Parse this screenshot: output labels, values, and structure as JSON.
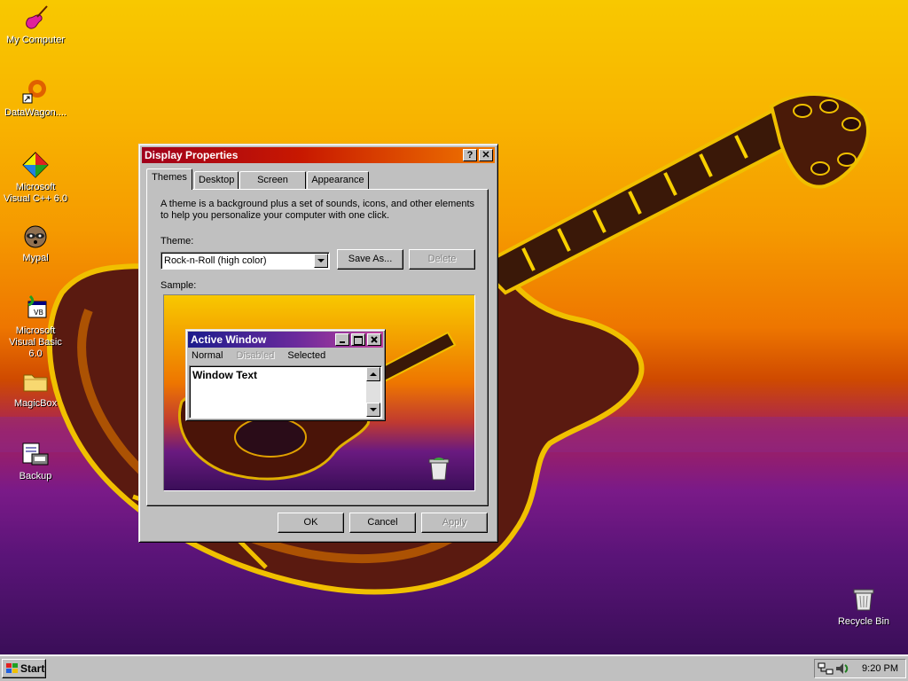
{
  "desktop": {
    "icons": [
      {
        "label": "My Computer",
        "icon": "guitar-icon"
      },
      {
        "label": "DataWagon....",
        "icon": "shortcut-icon"
      },
      {
        "label": "Microsoft Visual C++ 6.0",
        "icon": "visual-cpp-icon"
      },
      {
        "label": "Mypal",
        "icon": "raccoon-icon"
      },
      {
        "label": "Microsoft Visual Basic 6.0",
        "icon": "visual-basic-icon"
      },
      {
        "label": "MagicBox",
        "icon": "folder-icon"
      },
      {
        "label": "Backup",
        "icon": "backup-icon"
      },
      {
        "label": "Recycle Bin",
        "icon": "recycle-bin-icon"
      }
    ]
  },
  "dialog": {
    "title": "Display Properties",
    "help_glyph": "?",
    "close_glyph": "✕",
    "tabs": [
      {
        "label": "Themes",
        "active": true
      },
      {
        "label": "Desktop",
        "active": false
      },
      {
        "label": "Screen Saver",
        "active": false
      },
      {
        "label": "Appearance",
        "active": false
      }
    ],
    "description": "A theme is a background plus a set of sounds, icons, and other elements to help you personalize your computer with one click.",
    "theme_label": "Theme:",
    "theme_value": "Rock-n-Roll (high color)",
    "save_as_label": "Save As...",
    "delete_label": "Delete",
    "sample_label": "Sample:",
    "sample": {
      "window_title": "Active Window",
      "menu": [
        "Normal",
        "Disabled",
        "Selected"
      ],
      "window_text": "Window Text"
    },
    "ok_label": "OK",
    "cancel_label": "Cancel",
    "apply_label": "Apply"
  },
  "taskbar": {
    "start_label": "Start",
    "clock": "9:20 PM"
  },
  "colors": {
    "title_gradient_start": "#a0001c",
    "title_gradient_end": "#f07800",
    "sample_title_start": "#1c1c8c",
    "sample_title_end": "#c0409c",
    "face": "#c0c0c0"
  }
}
